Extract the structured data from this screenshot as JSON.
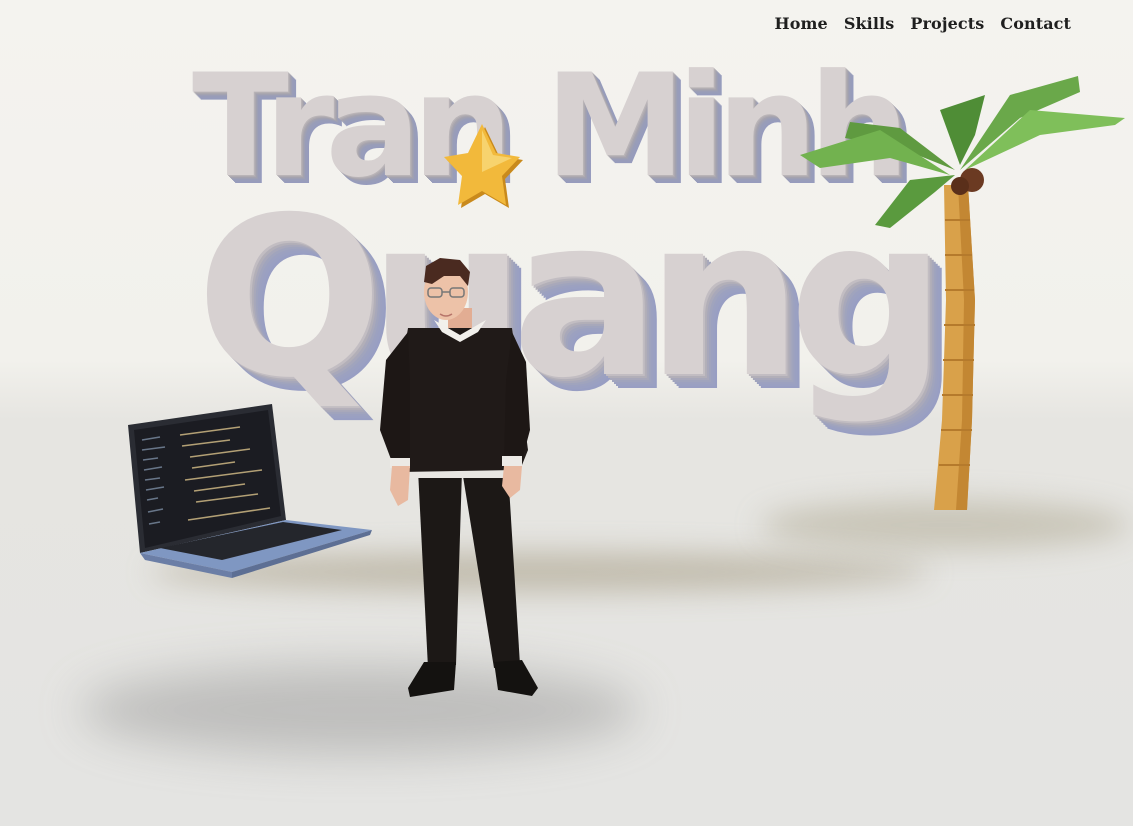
{
  "nav": {
    "items": [
      {
        "label": "Home"
      },
      {
        "label": "Skills"
      },
      {
        "label": "Projects"
      },
      {
        "label": "Contact"
      }
    ]
  },
  "hero": {
    "title_line_1": "Tran Minh",
    "title_line_2": "Quang"
  },
  "scene": {
    "objects": [
      "star-icon",
      "palm-tree",
      "laptop",
      "avatar"
    ]
  },
  "colors": {
    "background": "#f4f3ef",
    "floor": "#e4e4e2",
    "title_face": "#d7d1d1",
    "title_side": "#969bbd",
    "nav_text": "#1f1f1f",
    "star": "#f2b93b",
    "palm_leaf": "#6aa84a",
    "trunk": "#d9a14a",
    "laptop_body": "#7f97c2",
    "sweater": "#201a18"
  }
}
